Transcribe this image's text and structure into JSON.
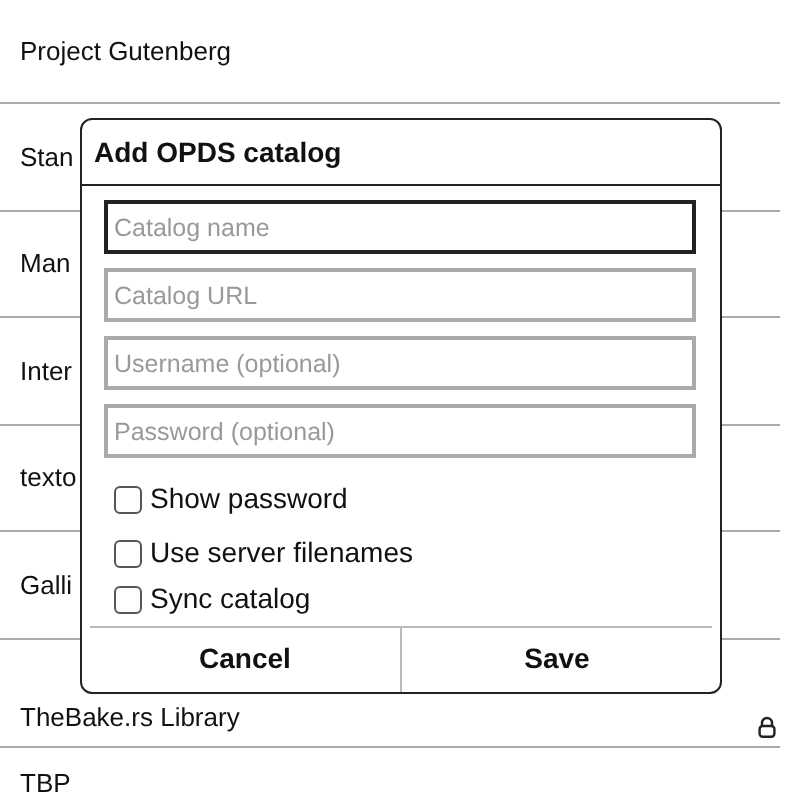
{
  "catalogs": [
    {
      "name": "Project Gutenberg",
      "locked": false
    },
    {
      "name": "Stan",
      "locked": false
    },
    {
      "name": "Man",
      "locked": false
    },
    {
      "name": "Inter",
      "locked": false
    },
    {
      "name": "texto",
      "locked": false
    },
    {
      "name": "Galli",
      "locked": false
    },
    {
      "name": "TheBake.rs Library",
      "locked": true
    },
    {
      "name": "TBP",
      "locked": false
    }
  ],
  "dialog": {
    "title": "Add OPDS catalog",
    "fields": [
      {
        "placeholder": "Catalog name",
        "focused": true
      },
      {
        "placeholder": "Catalog URL",
        "focused": false
      },
      {
        "placeholder": "Username (optional)",
        "focused": false
      },
      {
        "placeholder": "Password (optional)",
        "focused": false
      }
    ],
    "options": [
      {
        "label": "Show password",
        "checked": false
      },
      {
        "label": "Use server filenames",
        "checked": false
      },
      {
        "label": "Sync catalog",
        "checked": false
      }
    ],
    "buttons": [
      "Cancel",
      "Save"
    ]
  }
}
